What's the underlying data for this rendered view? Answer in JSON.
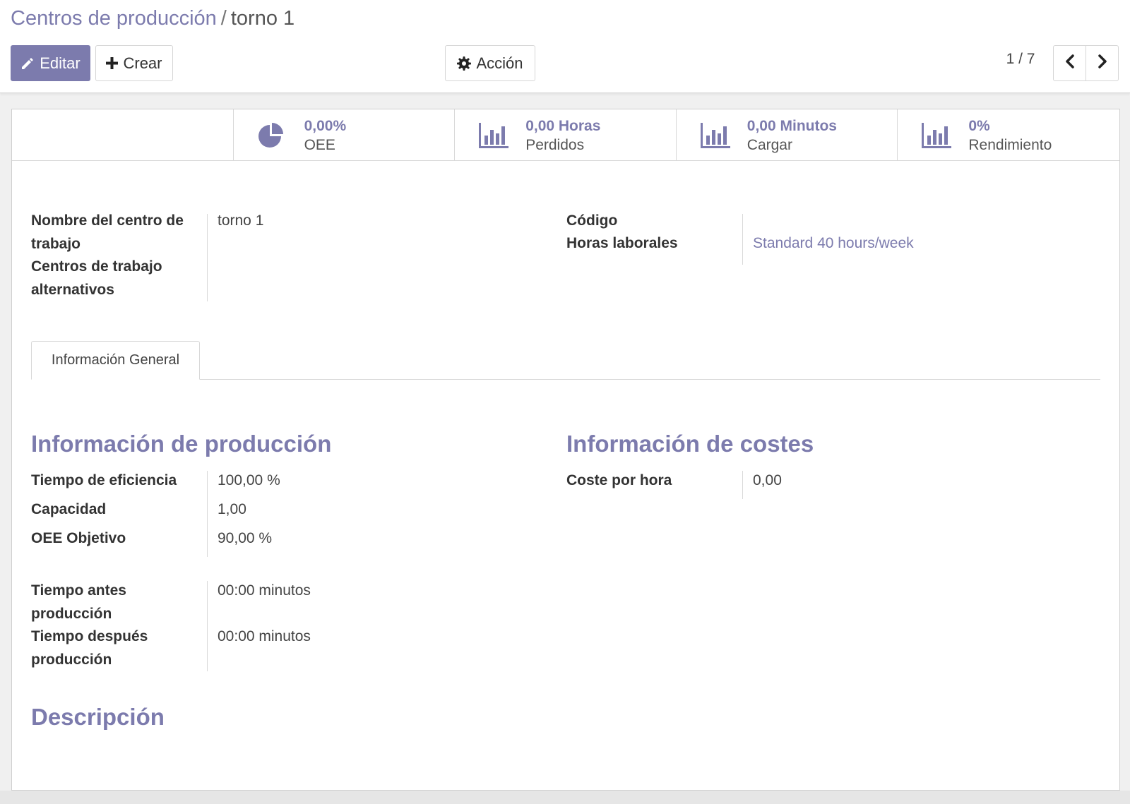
{
  "breadcrumb": {
    "parent": "Centros de producción",
    "separator": "/",
    "current": "torno 1"
  },
  "toolbar": {
    "edit_label": "Editar",
    "create_label": "Crear",
    "action_label": "Acción"
  },
  "pager": {
    "value": "1 / 7"
  },
  "stats": [
    {
      "value": "0,00%",
      "label": "OEE",
      "icon": "pie-chart-icon"
    },
    {
      "value": "0,00 Horas",
      "label": "Perdidos",
      "icon": "bar-chart-icon"
    },
    {
      "value": "0,00 Minutos",
      "label": "Cargar",
      "icon": "bar-chart-icon"
    },
    {
      "value": "0%",
      "label": "Rendimiento",
      "icon": "bar-chart-icon"
    }
  ],
  "header_fields": {
    "name_label": "Nombre del centro de trabajo",
    "name_value": "torno 1",
    "alternatives_label": "Centros de trabajo alternativos",
    "code_label": "Código",
    "hours_label": "Horas laborales",
    "hours_value": "Standard 40 hours/week"
  },
  "tabs": [
    {
      "label": "Información General"
    }
  ],
  "production": {
    "title": "Información de producción",
    "efficiency_label": "Tiempo de eficiencia",
    "efficiency_value": "100,00  %",
    "capacity_label": "Capacidad",
    "capacity_value": "1,00",
    "oee_target_label": "OEE Objetivo",
    "oee_target_value": "90,00  %",
    "time_before_label": "Tiempo antes producción",
    "time_before_value": "00:00 minutos",
    "time_after_label": "Tiempo después producción",
    "time_after_value": "00:00 minutos"
  },
  "costs": {
    "title": "Información de costes",
    "cost_hour_label": "Coste por hora",
    "cost_hour_value": "0,00"
  },
  "description": {
    "title": "Descripción"
  },
  "colors": {
    "accent": "#7c7bad",
    "text": "#444444",
    "border": "#d8d8d8"
  }
}
